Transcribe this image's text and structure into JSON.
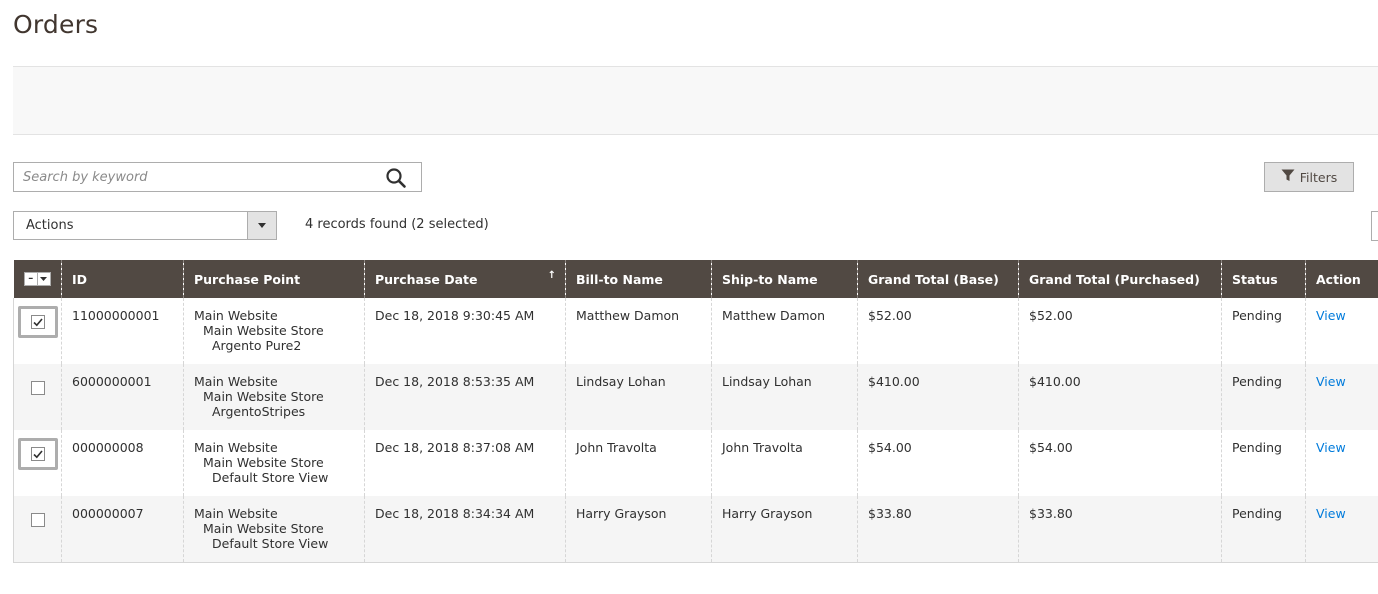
{
  "page": {
    "title": "Orders"
  },
  "search": {
    "placeholder": "Search by keyword"
  },
  "toolbar": {
    "filters_label": "Filters",
    "actions_label": "Actions",
    "records_text": "4 records found (2 selected)"
  },
  "grid": {
    "columns": [
      "ID",
      "Purchase Point",
      "Purchase Date",
      "Bill-to Name",
      "Ship-to Name",
      "Grand Total (Base)",
      "Grand Total (Purchased)",
      "Status",
      "Action"
    ],
    "sort_indicator": "↑",
    "rows": [
      {
        "selected": true,
        "id": "11000000001",
        "pp1": "Main Website",
        "pp2": "Main Website Store",
        "pp3": "Argento Pure2",
        "date": "Dec 18, 2018 9:30:45 AM",
        "bill": "Matthew Damon",
        "ship": "Matthew Damon",
        "base": "$52.00",
        "purchased": "$52.00",
        "status": "Pending",
        "action": "View"
      },
      {
        "selected": false,
        "id": "6000000001",
        "pp1": "Main Website",
        "pp2": "Main Website Store",
        "pp3": "ArgentoStripes",
        "date": "Dec 18, 2018 8:53:35 AM",
        "bill": "Lindsay Lohan",
        "ship": "Lindsay Lohan",
        "base": "$410.00",
        "purchased": "$410.00",
        "status": "Pending",
        "action": "View"
      },
      {
        "selected": true,
        "id": "000000008",
        "pp1": "Main Website",
        "pp2": "Main Website Store",
        "pp3": "Default Store View",
        "date": "Dec 18, 2018 8:37:08 AM",
        "bill": "John Travolta",
        "ship": "John Travolta",
        "base": "$54.00",
        "purchased": "$54.00",
        "status": "Pending",
        "action": "View"
      },
      {
        "selected": false,
        "id": "000000007",
        "pp1": "Main Website",
        "pp2": "Main Website Store",
        "pp3": "Default Store View",
        "date": "Dec 18, 2018 8:34:34 AM",
        "bill": "Harry Grayson",
        "ship": "Harry Grayson",
        "base": "$33.80",
        "purchased": "$33.80",
        "status": "Pending",
        "action": "View"
      }
    ]
  },
  "colors": {
    "header_bg": "#514943",
    "link": "#007bdb",
    "title": "#41362f"
  }
}
